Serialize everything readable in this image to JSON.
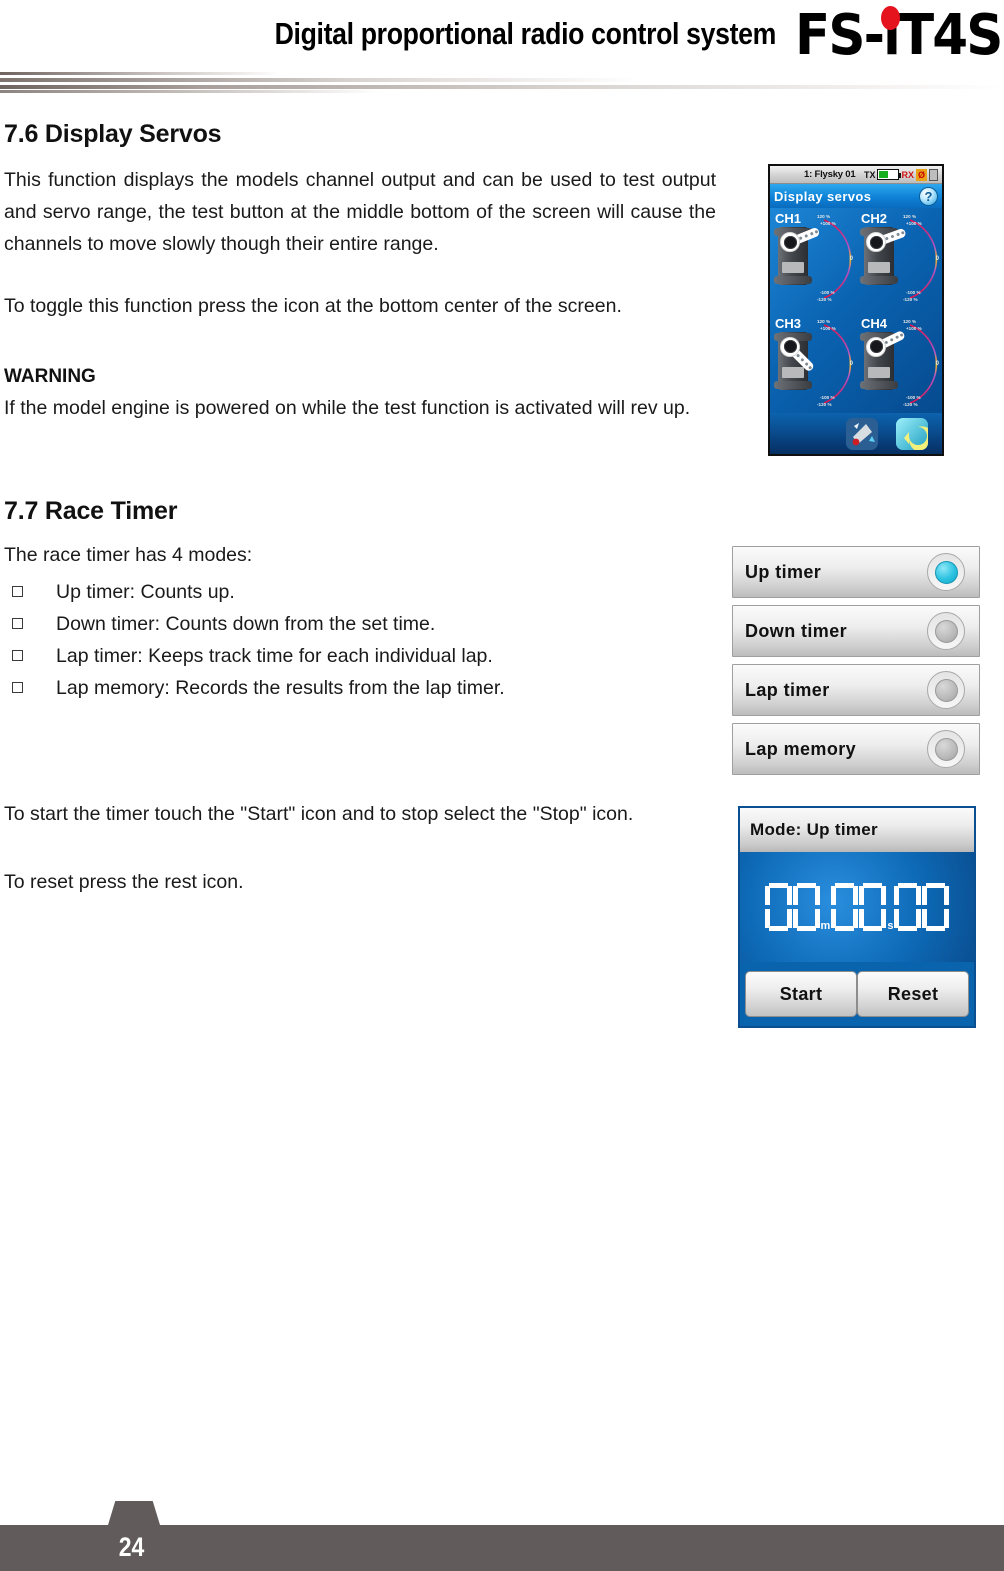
{
  "header": {
    "title": "Digital proportional radio control system",
    "logo_prefix": "FS-",
    "logo_suffix": "iT4S",
    "logo_dot_color": "#e4131d"
  },
  "sections": {
    "display_servos": {
      "heading": "7.6 Display Servos",
      "para1": "This function displays the models channel output and can be used to test output and servo range, the test button at the middle bottom of the screen will cause the channels to move slowly though their entire range.",
      "para2": "To toggle this function press the icon at the bottom center of the screen.",
      "warning_label": "WARNING",
      "warning_text": "If the model engine is powered on while the test function is activated will rev up."
    },
    "race_timer": {
      "heading": "7.7 Race Timer",
      "intro": "The race timer has 4 modes:",
      "bullets": [
        "Up timer: Counts up.",
        "Down timer: Counts down from the set time.",
        "Lap timer: Keeps track time for each individual lap.",
        "Lap memory: Records the results from the lap timer."
      ],
      "para_start_stop": "To start the timer touch the \"Start\" icon and to stop select the \"Stop\" icon.",
      "para_reset": "To reset press the rest icon."
    }
  },
  "servo_screen": {
    "status": {
      "model": "1: Flysky 01",
      "tx_label": "TX",
      "rx_label": "RX",
      "no_signal_glyph": "Ø"
    },
    "title": "Display servos",
    "help_glyph": "?",
    "channels": [
      {
        "label": "CH1",
        "arm_angle": -22,
        "gauge": {
          "top_outer": "120 %",
          "top_inner": "+100 %",
          "zero": "0",
          "bottom_inner": "-100 %",
          "bottom_outer": "-120 %"
        }
      },
      {
        "label": "CH2",
        "arm_angle": -20,
        "gauge": {
          "top_outer": "120 %",
          "top_inner": "+100 %",
          "zero": "0",
          "bottom_inner": "-100 %",
          "bottom_outer": "-120 %"
        }
      },
      {
        "label": "CH3",
        "arm_angle": 45,
        "gauge": {
          "top_outer": "120 %",
          "top_inner": "+100 %",
          "zero": "0",
          "bottom_inner": "-100 %",
          "bottom_outer": "-120 %"
        }
      },
      {
        "label": "CH4",
        "arm_angle": -26,
        "gauge": {
          "top_outer": "120 %",
          "top_inner": "+100 %",
          "zero": "0",
          "bottom_inner": "-100 %",
          "bottom_outer": "-120 %"
        }
      }
    ],
    "bottom_buttons": [
      {
        "name": "test-servo-icon"
      },
      {
        "name": "return-icon"
      }
    ]
  },
  "mode_list": {
    "items": [
      {
        "label": "Up timer",
        "selected": true
      },
      {
        "label": "Down timer",
        "selected": false
      },
      {
        "label": "Lap timer",
        "selected": false
      },
      {
        "label": "Lap memory",
        "selected": false
      }
    ],
    "selected_color": "#2bc2e0"
  },
  "timer_panel": {
    "mode_text": "Mode: Up timer",
    "digits": [
      "0",
      "0",
      "0",
      "0",
      "0",
      "0"
    ],
    "minute_unit": "m",
    "second_unit": "s",
    "start_label": "Start",
    "reset_label": "Reset"
  },
  "footer": {
    "page_number": "24"
  }
}
